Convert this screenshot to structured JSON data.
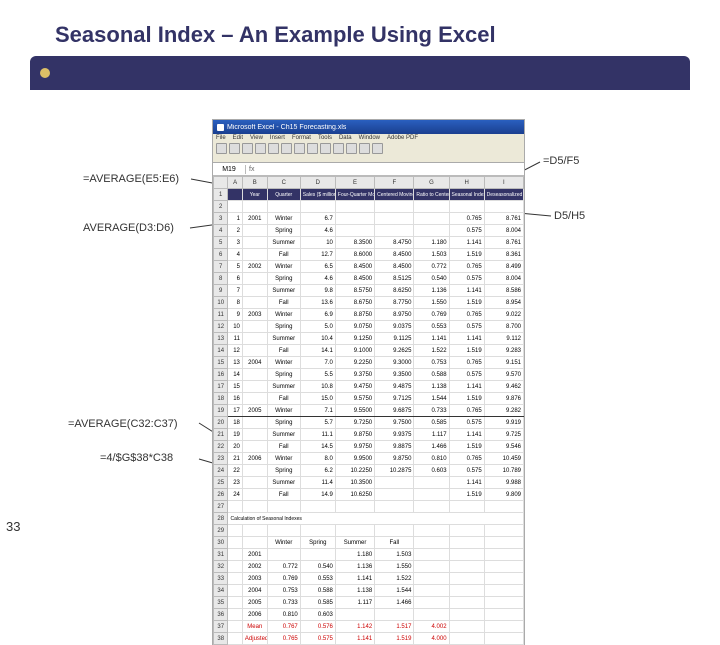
{
  "title": "Seasonal Index – An Example Using Excel",
  "slide_number": "33",
  "window_title": "Microsoft Excel - Ch15 Forecasting.xls",
  "menu": [
    "File",
    "Edit",
    "View",
    "Insert",
    "Format",
    "Tools",
    "Data",
    "Window",
    "Adobe PDF"
  ],
  "namebox": "M19",
  "callouts": {
    "c1": "=AVERAGE(E5:E6)",
    "c2": "AVERAGE(D3:D6)",
    "c3": "=AVERAGE(C32:C37)",
    "c4": "=4/$G$38*C38",
    "c5": "=D5/F5",
    "c6": "D5/H5"
  },
  "cols": [
    "A",
    "B",
    "C",
    "D",
    "E",
    "F",
    "G",
    "H",
    "I"
  ],
  "headers": [
    "",
    "Year",
    "Quarter",
    "Sales ($ millions)",
    "Four-Quarter Moving Average",
    "Centered Moving Average",
    "Ratio to Centered CMA",
    "Seasonal Indexes",
    "Deseasonalized"
  ],
  "rows": [
    {
      "n": "2",
      "a": ""
    },
    {
      "n": "3",
      "a": "1",
      "b": "2001",
      "c": "Winter",
      "d": "6.7",
      "e": "",
      "f": "",
      "g": "",
      "h": "0.765",
      "i": "8.761"
    },
    {
      "n": "4",
      "a": "2",
      "b": "",
      "c": "Spring",
      "d": "4.6",
      "e": "",
      "f": "",
      "g": "",
      "h": "0.575",
      "i": "8.004"
    },
    {
      "n": "5",
      "a": "3",
      "b": "",
      "c": "Summer",
      "d": "10",
      "e": "8.3500",
      "f": "8.4750",
      "g": "1.180",
      "h": "1.141",
      "i": "8.761"
    },
    {
      "n": "6",
      "a": "4",
      "b": "",
      "c": "Fall",
      "d": "12.7",
      "e": "8.6000",
      "f": "8.4500",
      "g": "1.503",
      "h": "1.519",
      "i": "8.361"
    },
    {
      "n": "7",
      "a": "5",
      "b": "2002",
      "c": "Winter",
      "d": "6.5",
      "e": "8.4500",
      "f": "8.4500",
      "g": "0.772",
      "h": "0.765",
      "i": "8.499"
    },
    {
      "n": "8",
      "a": "6",
      "b": "",
      "c": "Spring",
      "d": "4.6",
      "e": "8.4500",
      "f": "8.5125",
      "g": "0.540",
      "h": "0.575",
      "i": "8.004"
    },
    {
      "n": "9",
      "a": "7",
      "b": "",
      "c": "Summer",
      "d": "9.8",
      "e": "8.5750",
      "f": "8.6250",
      "g": "1.136",
      "h": "1.141",
      "i": "8.586"
    },
    {
      "n": "10",
      "a": "8",
      "b": "",
      "c": "Fall",
      "d": "13.6",
      "e": "8.6750",
      "f": "8.7750",
      "g": "1.550",
      "h": "1.519",
      "i": "8.954"
    },
    {
      "n": "11",
      "a": "9",
      "b": "2003",
      "c": "Winter",
      "d": "6.9",
      "e": "8.8750",
      "f": "8.9750",
      "g": "0.769",
      "h": "0.765",
      "i": "9.022"
    },
    {
      "n": "12",
      "a": "10",
      "b": "",
      "c": "Spring",
      "d": "5.0",
      "e": "9.0750",
      "f": "9.0375",
      "g": "0.553",
      "h": "0.575",
      "i": "8.700"
    },
    {
      "n": "13",
      "a": "11",
      "b": "",
      "c": "Summer",
      "d": "10.4",
      "e": "9.1250",
      "f": "9.1125",
      "g": "1.141",
      "h": "1.141",
      "i": "9.112"
    },
    {
      "n": "14",
      "a": "12",
      "b": "",
      "c": "Fall",
      "d": "14.1",
      "e": "9.1000",
      "f": "9.2625",
      "g": "1.522",
      "h": "1.519",
      "i": "9.283"
    },
    {
      "n": "15",
      "a": "13",
      "b": "2004",
      "c": "Winter",
      "d": "7.0",
      "e": "9.2250",
      "f": "9.3000",
      "g": "0.753",
      "h": "0.765",
      "i": "9.151"
    },
    {
      "n": "16",
      "a": "14",
      "b": "",
      "c": "Spring",
      "d": "5.5",
      "e": "9.3750",
      "f": "9.3500",
      "g": "0.588",
      "h": "0.575",
      "i": "9.570"
    },
    {
      "n": "17",
      "a": "15",
      "b": "",
      "c": "Summer",
      "d": "10.8",
      "e": "9.4750",
      "f": "9.4875",
      "g": "1.138",
      "h": "1.141",
      "i": "9.462"
    },
    {
      "n": "18",
      "a": "16",
      "b": "",
      "c": "Fall",
      "d": "15.0",
      "e": "9.5750",
      "f": "9.7125",
      "g": "1.544",
      "h": "1.519",
      "i": "9.876"
    },
    {
      "n": "19",
      "a": "17",
      "b": "2005",
      "c": "Winter",
      "d": "7.1",
      "e": "9.5500",
      "f": "9.6875",
      "g": "0.733",
      "h": "0.765",
      "i": "9.282",
      "sel": true
    },
    {
      "n": "20",
      "a": "18",
      "b": "",
      "c": "Spring",
      "d": "5.7",
      "e": "9.7250",
      "f": "9.7500",
      "g": "0.585",
      "h": "0.575",
      "i": "9.919"
    },
    {
      "n": "21",
      "a": "19",
      "b": "",
      "c": "Summer",
      "d": "11.1",
      "e": "9.8750",
      "f": "9.9375",
      "g": "1.117",
      "h": "1.141",
      "i": "9.725"
    },
    {
      "n": "22",
      "a": "20",
      "b": "",
      "c": "Fall",
      "d": "14.5",
      "e": "9.9750",
      "f": "9.8875",
      "g": "1.466",
      "h": "1.519",
      "i": "9.546"
    },
    {
      "n": "23",
      "a": "21",
      "b": "2006",
      "c": "Winter",
      "d": "8.0",
      "e": "9.9500",
      "f": "9.8750",
      "g": "0.810",
      "h": "0.765",
      "i": "10.459"
    },
    {
      "n": "24",
      "a": "22",
      "b": "",
      "c": "Spring",
      "d": "6.2",
      "e": "10.2250",
      "f": "10.2875",
      "g": "0.603",
      "h": "0.575",
      "i": "10.789"
    },
    {
      "n": "25",
      "a": "23",
      "b": "",
      "c": "Summer",
      "d": "11.4",
      "e": "10.3500",
      "f": "",
      "g": "",
      "h": "1.141",
      "i": "9.988"
    },
    {
      "n": "26",
      "a": "24",
      "b": "",
      "c": "Fall",
      "d": "14.9",
      "e": "10.6250",
      "f": "",
      "g": "",
      "h": "1.519",
      "i": "9.809"
    }
  ],
  "calc_title": "Calculation of Seasonal Indexes",
  "quarters": [
    "Winter",
    "Spring",
    "Summer",
    "Fall"
  ],
  "calc_rows": [
    {
      "n": "31",
      "yr": "2001",
      "v": [
        "",
        "",
        "1.180",
        "1.503"
      ]
    },
    {
      "n": "32",
      "yr": "2002",
      "v": [
        "0.772",
        "0.540",
        "1.136",
        "1.550"
      ]
    },
    {
      "n": "33",
      "yr": "2003",
      "v": [
        "0.769",
        "0.553",
        "1.141",
        "1.522"
      ]
    },
    {
      "n": "34",
      "yr": "2004",
      "v": [
        "0.753",
        "0.588",
        "1.138",
        "1.544"
      ]
    },
    {
      "n": "35",
      "yr": "2005",
      "v": [
        "0.733",
        "0.585",
        "1.117",
        "1.466"
      ]
    },
    {
      "n": "36",
      "yr": "2006",
      "v": [
        "0.810",
        "0.603",
        "",
        ""
      ]
    },
    {
      "n": "37",
      "yr": "Mean",
      "v": [
        "0.767",
        "0.576",
        "1.142",
        "1.517"
      ],
      "g": "4.002"
    },
    {
      "n": "38",
      "yr": "Adjusted",
      "v": [
        "0.765",
        "0.575",
        "1.141",
        "1.519"
      ],
      "g": "4.000"
    }
  ]
}
